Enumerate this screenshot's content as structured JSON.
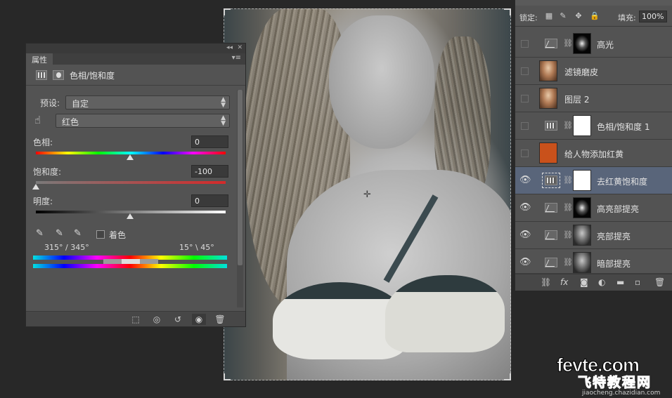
{
  "properties_panel": {
    "tab_label": "属性",
    "header_title": "色相/饱和度",
    "preset_label": "预设:",
    "preset_value": "自定",
    "channel_value": "红色",
    "hue_label": "色相:",
    "hue_value": "0",
    "saturation_label": "饱和度:",
    "saturation_value": "-100",
    "lightness_label": "明度:",
    "lightness_value": "0",
    "colorize_label": "着色",
    "range_left": "315° / 345°",
    "range_right": "15° \\ 45°"
  },
  "layers_panel": {
    "lock_label": "锁定:",
    "fill_label": "填充:",
    "fill_value": "100%",
    "layers": [
      {
        "name": "高光",
        "visible": false,
        "type": "curves-with-mask"
      },
      {
        "name": "滤镜磨皮",
        "visible": false,
        "type": "photo"
      },
      {
        "name": "图层 2",
        "visible": false,
        "type": "photo"
      },
      {
        "name": "色相/饱和度 1",
        "visible": false,
        "type": "hue-sat-with-mask"
      },
      {
        "name": "给人物添加红黄",
        "visible": false,
        "type": "color-fill"
      },
      {
        "name": "去红黄饱和度",
        "visible": true,
        "type": "hue-sat-with-mask",
        "selected": true
      },
      {
        "name": "高亮部提亮",
        "visible": true,
        "type": "curves-with-mask"
      },
      {
        "name": "亮部提亮",
        "visible": true,
        "type": "curves-with-mask"
      },
      {
        "name": "暗部提亮",
        "visible": true,
        "type": "curves-with-mask"
      }
    ]
  },
  "colors": {
    "panel_bg": "#535353",
    "selected_layer": "#59657a",
    "color_fill_swatch": "#c9511b",
    "workspace_bg": "#282828"
  },
  "watermark": {
    "brand": "fevte.com",
    "cn": "飞特教程网",
    "url": "jiaocheng.chazidian.com"
  }
}
